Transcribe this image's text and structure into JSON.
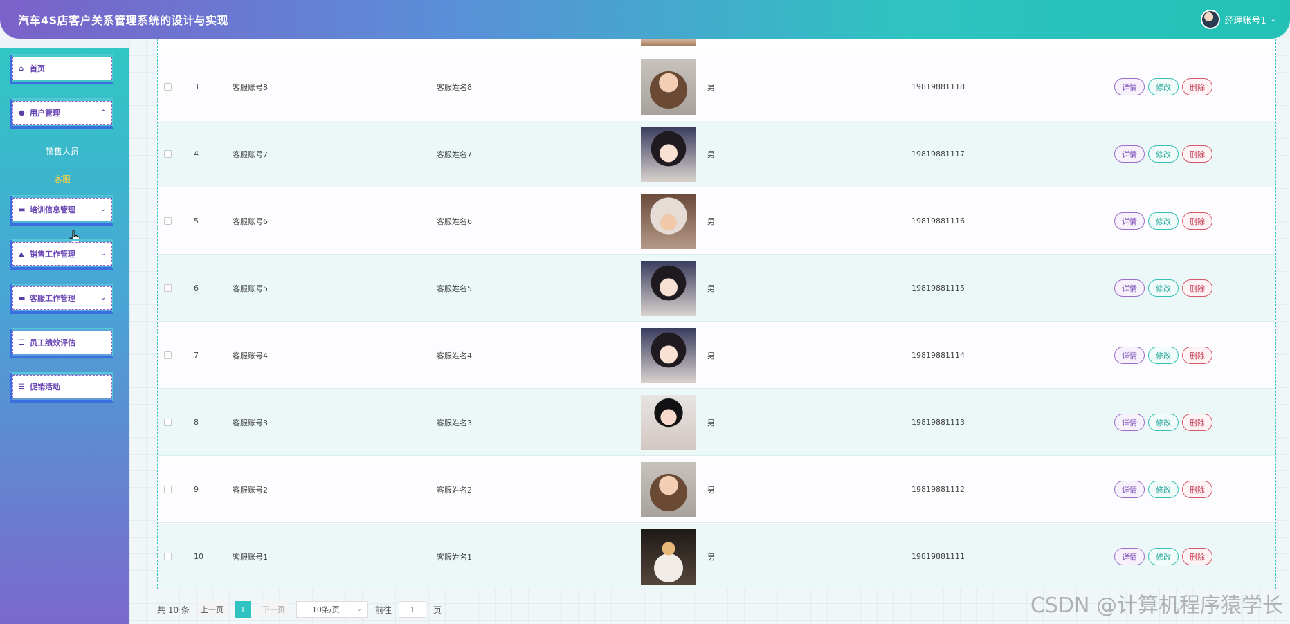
{
  "header": {
    "title": "汽车4S店客户关系管理系统的设计与实现",
    "user": "经理账号1"
  },
  "sidebar": {
    "items": [
      {
        "label": "首页",
        "icon": "home-icon"
      },
      {
        "label": "用户管理",
        "icon": "user-icon"
      },
      {
        "label": "培训信息管理",
        "icon": "folder-icon"
      },
      {
        "label": "销售工作管理",
        "icon": "bank-icon"
      },
      {
        "label": "客服工作管理",
        "icon": "folder-icon"
      },
      {
        "label": "员工绩效评估",
        "icon": "list-icon"
      },
      {
        "label": "促销活动",
        "icon": "list-icon"
      }
    ],
    "sub_items": [
      {
        "label": "销售人员"
      },
      {
        "label": "客服"
      }
    ]
  },
  "table": {
    "rows": [
      {
        "idx": "3",
        "account": "客服账号8",
        "name": "客服姓名8",
        "sex": "男",
        "phone": "19819881118"
      },
      {
        "idx": "4",
        "account": "客服账号7",
        "name": "客服姓名7",
        "sex": "男",
        "phone": "19819881117"
      },
      {
        "idx": "5",
        "account": "客服账号6",
        "name": "客服姓名6",
        "sex": "男",
        "phone": "19819881116"
      },
      {
        "idx": "6",
        "account": "客服账号5",
        "name": "客服姓名5",
        "sex": "男",
        "phone": "19819881115"
      },
      {
        "idx": "7",
        "account": "客服账号4",
        "name": "客服姓名4",
        "sex": "男",
        "phone": "19819881114"
      },
      {
        "idx": "8",
        "account": "客服账号3",
        "name": "客服姓名3",
        "sex": "男",
        "phone": "19819881113"
      },
      {
        "idx": "9",
        "account": "客服账号2",
        "name": "客服姓名2",
        "sex": "男",
        "phone": "19819881112"
      },
      {
        "idx": "10",
        "account": "客服账号1",
        "name": "客服姓名1",
        "sex": "男",
        "phone": "19819881111"
      }
    ],
    "actions": {
      "detail": "详情",
      "edit": "修改",
      "delete": "删除"
    }
  },
  "pager": {
    "total": "共 10 条",
    "prev": "上一页",
    "current": "1",
    "next": "下一页",
    "page_size": "10条/页",
    "goto": "前往",
    "goto_value": "1",
    "page_unit": "页"
  },
  "watermark": "CSDN @计算机程序猿学长",
  "colors": {
    "accent": "#2ec3c0",
    "header_start": "#7b61c9",
    "active_sub": "#f1d24a"
  }
}
